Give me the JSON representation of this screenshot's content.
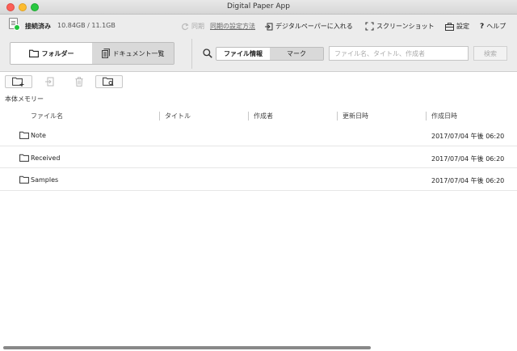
{
  "window": {
    "title": "Digital Paper App"
  },
  "status": {
    "connection": "接続済み",
    "storage": "10.84GB / 11.1GB",
    "color": "#1fc43b"
  },
  "toolbar": {
    "sync_label": "同期",
    "sync_settings_label": "同期の設定方法",
    "insert_label": "デジタルペーパーに入れる",
    "screenshot_label": "スクリーンショット",
    "settings_label": "設定",
    "help_label": "ヘルプ"
  },
  "view_tabs": {
    "folder": "フォルダー",
    "documents": "ドキュメント一覧"
  },
  "search": {
    "mode_file_info": "ファイル情報",
    "mode_mark": "マーク",
    "placeholder": "ファイル名、タイトル、作成者",
    "button_label": "検索"
  },
  "location": {
    "label": "本体メモリー"
  },
  "columns": {
    "name": "ファイル名",
    "title": "タイトル",
    "author": "作成者",
    "modified": "更新日時",
    "created": "作成日時"
  },
  "rows": [
    {
      "name": "Note",
      "created": "2017/07/04 午後 06:20"
    },
    {
      "name": "Received",
      "created": "2017/07/04 午後 06:20"
    },
    {
      "name": "Samples",
      "created": "2017/07/04 午後 06:20"
    }
  ],
  "icons": {
    "sync": "sync-icon",
    "insert": "insert-icon",
    "screenshot": "screenshot-icon",
    "settings": "toolbox-icon",
    "help": "question-icon",
    "folder": "folder-icon",
    "documents": "document-list-icon",
    "search": "search-icon"
  }
}
